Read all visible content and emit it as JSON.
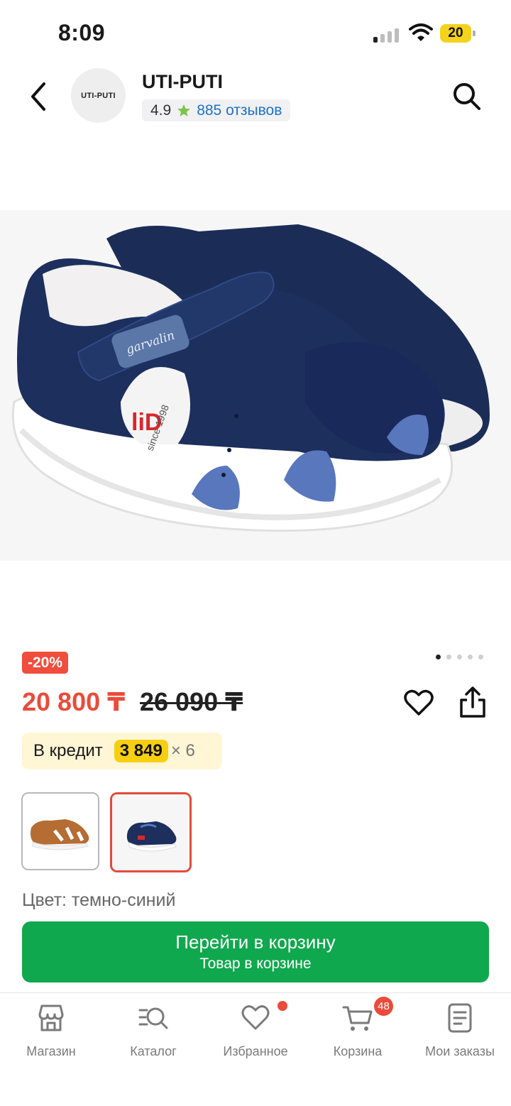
{
  "status_bar": {
    "time": "8:09",
    "battery": "20"
  },
  "header": {
    "shop_logo_text": "UTI-PUTI",
    "shop_name": "UTI-PUTI",
    "rating": "4.9",
    "reviews": "885 отзывов"
  },
  "product": {
    "image_icon": "sandal-image",
    "sandal_brand_tag": "garvalin",
    "insole_text": "since 1998",
    "discount_badge": "-20%",
    "price": "20 800 ₸",
    "old_price": "26 090 ₸",
    "gallery_count": 5,
    "gallery_active": 0
  },
  "credit": {
    "label": "В кредит",
    "amount": "3 849",
    "multiplier": "× 6"
  },
  "variants": [
    {
      "color": "коричневый",
      "selected": false
    },
    {
      "color": "темно-синий",
      "selected": true
    }
  ],
  "color_label": "Цвет: темно-синий",
  "cart_button": {
    "title": "Перейти в корзину",
    "subtitle": "Товар в корзине"
  },
  "tabbar": {
    "items": [
      {
        "label": "Магазин",
        "icon": "shop-icon"
      },
      {
        "label": "Каталог",
        "icon": "catalog-icon"
      },
      {
        "label": "Избранное",
        "icon": "heart-icon"
      },
      {
        "label": "Корзина",
        "icon": "cart-icon"
      },
      {
        "label": "Мои заказы",
        "icon": "orders-icon"
      }
    ],
    "cart_badge": "48"
  },
  "colors": {
    "accent_red": "#ea4b3b",
    "cart_green": "#10a84e",
    "link_blue": "#1d73c9",
    "credit_yellow": "#f7cf10",
    "rating_star": "#7bc44c"
  }
}
